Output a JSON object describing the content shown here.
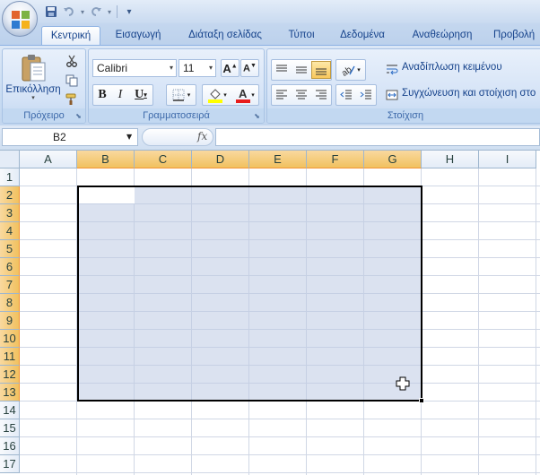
{
  "tabs": [
    "Κεντρική",
    "Εισαγωγή",
    "Διάταξη σελίδας",
    "Τύποι",
    "Δεδομένα",
    "Αναθεώρηση",
    "Προβολή"
  ],
  "ribbon": {
    "clipboard": {
      "label": "Πρόχειρο",
      "paste": "Επικόλληση"
    },
    "font": {
      "label": "Γραμματοσειρά",
      "name": "Calibri",
      "size": "11"
    },
    "alignment": {
      "label": "Στοίχιση",
      "wrap_text": "Αναδίπλωση κειμένου",
      "merge_center": "Συγχώνευση και στοίχιση στο"
    }
  },
  "formula_bar": {
    "name_box": "B2",
    "fx": "fx",
    "formula": ""
  },
  "columns": [
    "A",
    "B",
    "C",
    "D",
    "E",
    "F",
    "G",
    "H",
    "I"
  ],
  "rows": [
    "1",
    "2",
    "3",
    "4",
    "5",
    "6",
    "7",
    "8",
    "9",
    "10",
    "11",
    "12",
    "13",
    "14",
    "15",
    "16",
    "17"
  ],
  "selection": {
    "range": "B2:G13",
    "active_cell": "B2",
    "selected_columns": [
      "B",
      "C",
      "D",
      "E",
      "F",
      "G"
    ],
    "selected_rows": [
      "2",
      "3",
      "4",
      "5",
      "6",
      "7",
      "8",
      "9",
      "10",
      "11",
      "12",
      "13"
    ]
  },
  "colors": {
    "selected_header": "#f1c15f",
    "selection_fill": "#bec9e4",
    "gridline": "#d0d7e5",
    "ribbon_text": "#15428b"
  }
}
